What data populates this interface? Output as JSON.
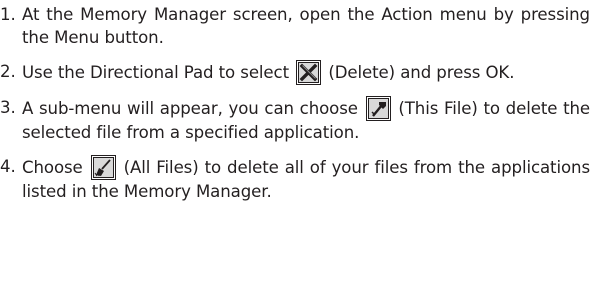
{
  "instructions": {
    "steps": [
      {
        "number": "1.",
        "text": "At the Memory Manager screen, open the Action menu by pressing the Menu button."
      },
      {
        "number": "2.",
        "text_before": "Use the Directional Pad to select",
        "icon": "delete-x-icon",
        "text_after": "(Delete) and press OK."
      },
      {
        "number": "3.",
        "text_before": "A sub-menu will appear, you can choose",
        "icon": "this-file-icon",
        "text_after": "(This File) to delete the selected file from a specified application."
      },
      {
        "number": "4.",
        "text_before": "Choose",
        "icon": "all-files-broom-icon",
        "text_after": "(All Files) to delete all of your files from the applications listed in the Memory Manager."
      }
    ]
  }
}
